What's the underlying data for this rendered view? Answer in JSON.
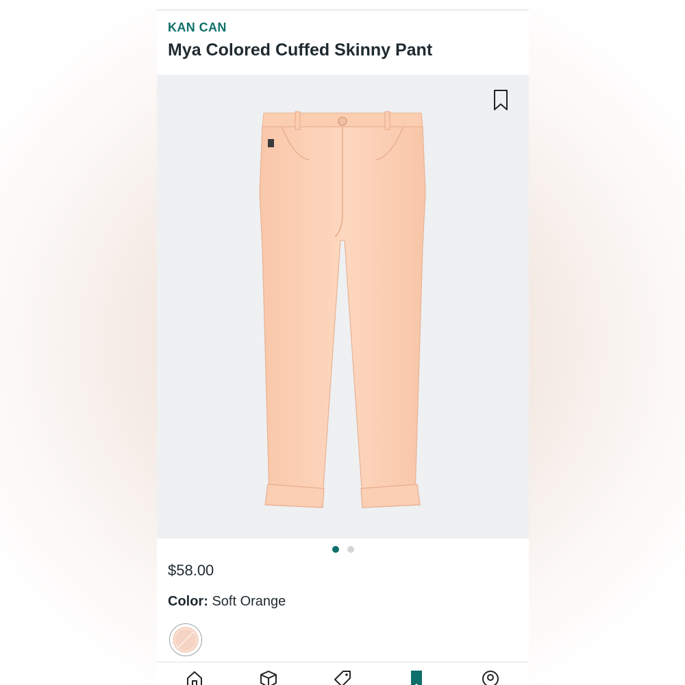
{
  "product": {
    "brand": "KAN CAN",
    "name": "Mya Colored Cuffed Skinny Pant",
    "price": "$58.00",
    "color_label": "Color:",
    "color_value": "Soft Orange",
    "swatch_color": "#f6d3c2"
  },
  "gallery": {
    "image_count": 2,
    "active_index": 0,
    "dot_active_color": "#0f6f6a"
  },
  "icons": {
    "bookmark": "bookmark-outline-icon",
    "nav": [
      "home-icon",
      "box-icon",
      "tag-icon",
      "bookmark-filled-icon",
      "profile-icon"
    ]
  },
  "colors": {
    "accent": "#0f6f6a",
    "pants": "#fbcfb4",
    "image_bg": "#eef0f2"
  }
}
